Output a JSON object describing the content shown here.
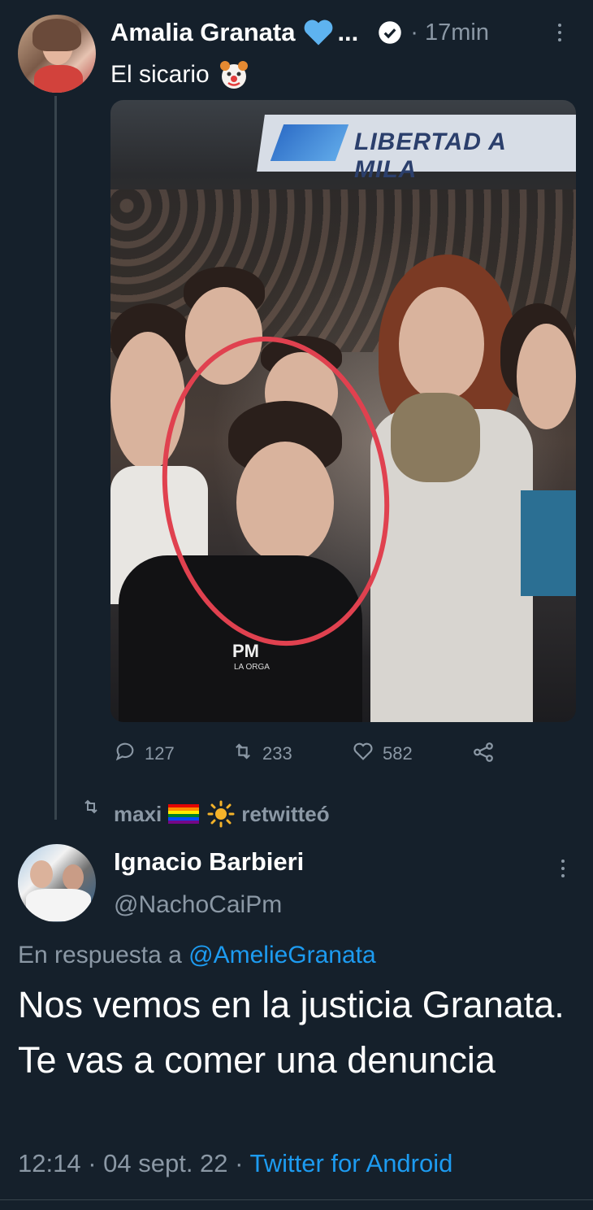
{
  "tweet1": {
    "author_name": "Amalia Granata",
    "name_suffix": "...",
    "time": "· 17min",
    "text": "El sicario",
    "stats": {
      "replies": "127",
      "retweets": "233",
      "likes": "582"
    }
  },
  "photo": {
    "banner_text": "LIBERTAD A MILA",
    "shirt_text": "PM",
    "shirt_subtext": "LA ORGA"
  },
  "retweet": {
    "user": "maxi",
    "action": "retwitteó"
  },
  "tweet2": {
    "author_name": "Ignacio Barbieri",
    "handle": "@NachoCaiPm",
    "reply_prefix": "En respuesta a",
    "reply_to": "@AmelieGranata",
    "text": "Nos vemos en la justicia Granata. Te vas a comer una denuncia",
    "time_date": "12:14 · 04 sept. 22 ·",
    "source": "Twitter for Android"
  },
  "colors": {
    "background": "#15202b",
    "accent": "#1d9bf0",
    "muted": "#8b98a5",
    "highlight_circle": "#e0414f"
  },
  "icons": [
    "blue-heart-icon",
    "verified-badge-icon",
    "more-options-icon",
    "clown-face-icon",
    "reply-icon",
    "retweet-icon",
    "like-icon",
    "share-icon",
    "rainbow-flag-icon",
    "sun-icon"
  ]
}
